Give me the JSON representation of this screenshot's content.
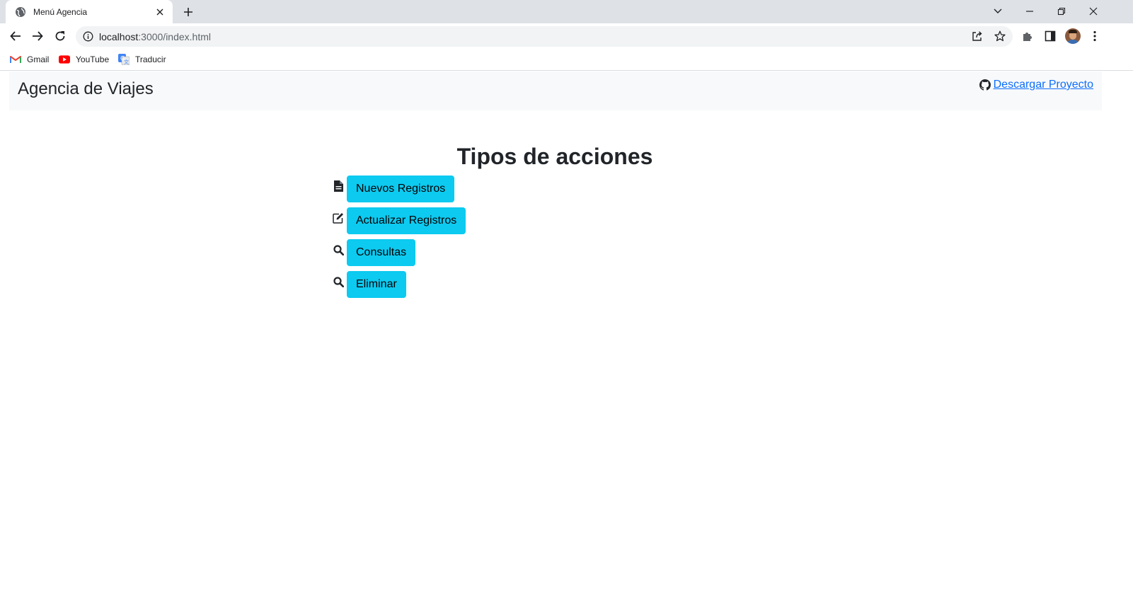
{
  "browser": {
    "tab_title": "Menú Agencia",
    "url_host": "localhost",
    "url_rest": ":3000/index.html",
    "bookmarks": [
      {
        "label": "Gmail",
        "icon": "gmail-icon"
      },
      {
        "label": "YouTube",
        "icon": "youtube-icon"
      },
      {
        "label": "Traducir",
        "icon": "google-translate-icon"
      }
    ]
  },
  "navbar": {
    "brand": "Agencia de Viajes",
    "download_label": "Descargar Proyecto",
    "download_icon": "github-icon"
  },
  "main": {
    "heading": "Tipos de acciones",
    "actions": [
      {
        "label": "Nuevos Registros",
        "icon": "file-text-icon"
      },
      {
        "label": "Actualizar Registros",
        "icon": "edit-icon"
      },
      {
        "label": "Consultas",
        "icon": "search-icon"
      },
      {
        "label": "Eliminar",
        "icon": "search-icon"
      }
    ]
  },
  "colors": {
    "button_info": "#0dcaf0",
    "link": "#0d6efd",
    "navbar_bg": "#f8f9fa",
    "text": "#212529"
  }
}
